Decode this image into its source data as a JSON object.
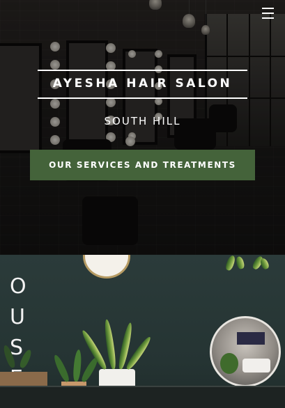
{
  "header": {
    "menu_icon": "hamburger-menu-icon"
  },
  "hero": {
    "title": "AYESHA HAIR SALON",
    "subtitle": "SOUTH HILL",
    "cta_label": "OUR SERVICES AND TREATMENTS",
    "background": "dark salon interior with lit vanity mirrors",
    "cta_color": "#44633a"
  },
  "salon_section": {
    "wall_sign": [
      "O",
      "U",
      "S",
      "E"
    ]
  }
}
